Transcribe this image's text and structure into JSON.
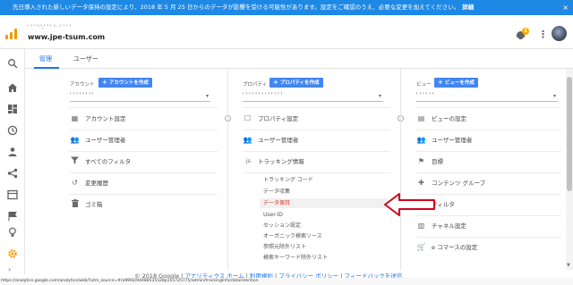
{
  "banner": {
    "text": "先日導入された新しいデータ保持の設定により、2018 年 5 月 25 日からのデータが影響を受ける可能性があります。設定をご確認のうえ、必要な変更を加えてください。",
    "detail_link": "詳細",
    "close": "×"
  },
  "header": {
    "account_breadcrumb": "' ' ' '·',' ' ' '· ·' ' ' '",
    "account_name": "www.jpe-tsum.com",
    "notification_count": "1"
  },
  "tabs": [
    {
      "label": "管理"
    },
    {
      "label": "ユーザー"
    }
  ],
  "account": {
    "label": "アカウント",
    "create": "アカウントを作成",
    "selector": "' ' ' ' ' ' ' '",
    "items": [
      {
        "icon": "building-icon",
        "label": "アカウント設定"
      },
      {
        "icon": "users-icon",
        "label": "ユーザー管理者"
      },
      {
        "icon": "filter-icon",
        "label": "すべてのフィルタ"
      },
      {
        "icon": "history-icon",
        "label": "変更履歴"
      },
      {
        "icon": "trash-icon",
        "label": "ゴミ箱"
      }
    ]
  },
  "property": {
    "label": "プロパティ",
    "create": "プロパティを作成",
    "selector": "' ' ' ' ' ' ' ' ' ' ' ' '",
    "items": [
      {
        "icon": "square-icon",
        "label": "プロパティ設定"
      },
      {
        "icon": "users-icon",
        "label": "ユーザー管理者"
      },
      {
        "icon": "js-icon",
        "label": "トラッキング情報"
      }
    ],
    "tracking_sub": [
      {
        "label": "トラッキング コード"
      },
      {
        "label": "データ収集"
      },
      {
        "label": "データ保持"
      },
      {
        "label": "User-ID"
      },
      {
        "label": "セッション設定"
      },
      {
        "label": "オーガニック検索ソース"
      },
      {
        "label": "参照元除外リスト"
      },
      {
        "label": "検索キーワード除外リスト"
      }
    ]
  },
  "view": {
    "label": "ビュー",
    "create": "ビューを作成",
    "selector": "' ' ' ' ' '",
    "items": [
      {
        "icon": "doc-icon",
        "label": "ビューの設定"
      },
      {
        "icon": "users-icon",
        "label": "ユーザー管理者"
      },
      {
        "icon": "flag-icon",
        "label": "目標"
      },
      {
        "icon": "puzzle-icon",
        "label": "コンテンツ グループ"
      },
      {
        "icon": "filter-icon",
        "label": "フィルタ"
      },
      {
        "icon": "channel-icon",
        "label": "チャネル設定"
      },
      {
        "icon": "cart-icon",
        "label": "e コマースの設定"
      }
    ]
  },
  "footer": {
    "copyright": "© 2018 Google |",
    "links": [
      "アナリティクス ホーム",
      "利用規約",
      "プライバシー ポリシー",
      "フィードバックを送信"
    ],
    "separator": " | "
  },
  "status_url": "https://analytics.google.com/analytics/web/?utm_source=#/a9992/94488535528p155725775/admin/trackingInfo/dataretention",
  "colors": {
    "banner": "#1e88e5",
    "accent": "#1a73e8",
    "create_button": "#4285f4",
    "logo": "#f29900",
    "highlight_text": "#d93025"
  }
}
